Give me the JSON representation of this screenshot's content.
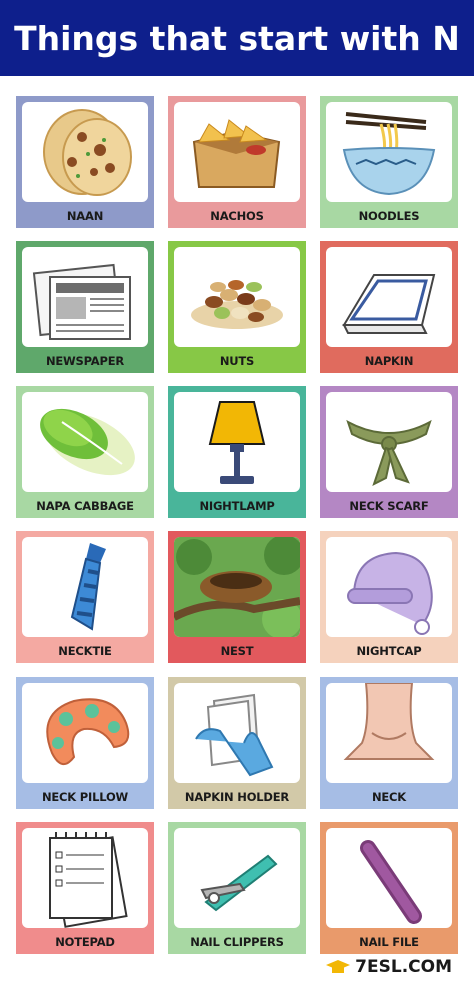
{
  "title": "Things that start with N",
  "footer": {
    "brand": "7ESL.COM"
  },
  "colors": {
    "header": "#0e1f8c"
  },
  "cards": [
    {
      "label": "NAAN",
      "icon": "naan-icon",
      "color": "#8e9ac9"
    },
    {
      "label": "NACHOS",
      "icon": "nachos-icon",
      "color": "#e99a9c"
    },
    {
      "label": "NOODLES",
      "icon": "noodles-icon",
      "color": "#a8d8a3"
    },
    {
      "label": "NEWSPAPER",
      "icon": "newspaper-icon",
      "color": "#5fa86b"
    },
    {
      "label": "NUTS",
      "icon": "nuts-icon",
      "color": "#87c846"
    },
    {
      "label": "NAPKIN",
      "icon": "napkin-icon",
      "color": "#e06b5e"
    },
    {
      "label": "NAPA CABBAGE",
      "icon": "cabbage-icon",
      "color": "#a8d8a3"
    },
    {
      "label": "NIGHTLAMP",
      "icon": "lamp-icon",
      "color": "#49b59a"
    },
    {
      "label": "NECK SCARF",
      "icon": "scarf-icon",
      "color": "#b487c4"
    },
    {
      "label": "NECKTIE",
      "icon": "necktie-icon",
      "color": "#f4a9a2"
    },
    {
      "label": "NEST",
      "icon": "nest-icon",
      "color": "#e2595d"
    },
    {
      "label": "NIGHTCAP",
      "icon": "nightcap-icon",
      "color": "#f5d2bd"
    },
    {
      "label": "NECK PILLOW",
      "icon": "pillow-icon",
      "color": "#a6bde5"
    },
    {
      "label": "NAPKIN HOLDER",
      "icon": "napkin-holder-icon",
      "color": "#d2c9a8"
    },
    {
      "label": "NECK",
      "icon": "neck-icon",
      "color": "#a6bde5"
    },
    {
      "label": "NOTEPAD",
      "icon": "notepad-icon",
      "color": "#f08c8c"
    },
    {
      "label": "NAIL CLIPPERS",
      "icon": "nail-clippers-icon",
      "color": "#a8d8a3"
    },
    {
      "label": "NAIL FILE",
      "icon": "nail-file-icon",
      "color": "#e99a6b"
    }
  ]
}
